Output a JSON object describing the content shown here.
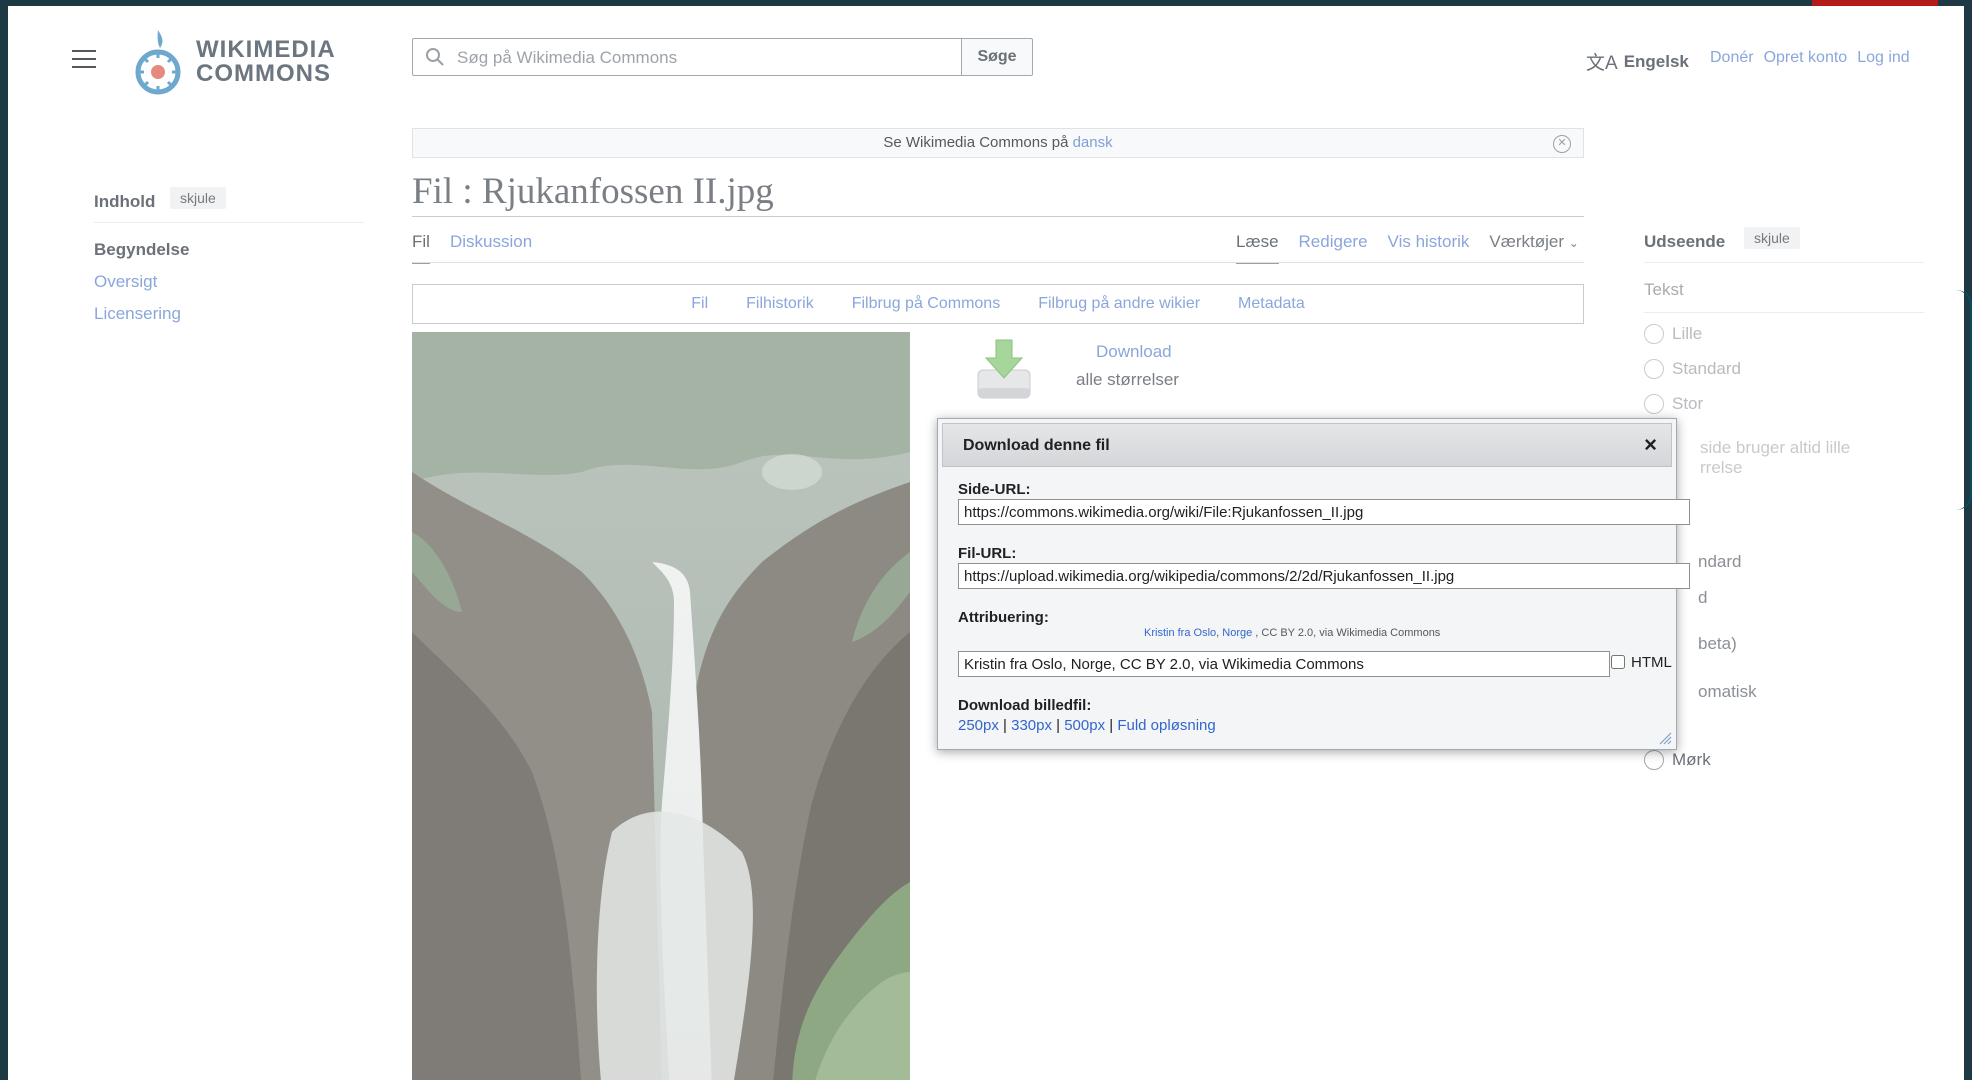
{
  "header": {
    "logo_line1": "WIKIMEDIA",
    "logo_line2": "COMMONS",
    "search_placeholder": "Søg på Wikimedia Commons",
    "search_button": "Søge",
    "language": "Engelsk",
    "language_icon": "translate-icon",
    "user_links": [
      "Donér",
      "Opret konto",
      "Log ind"
    ]
  },
  "site_notice": {
    "text": "Se Wikimedia Commons på",
    "link": "dansk"
  },
  "toc": {
    "title": "Indhold",
    "hide": "skjule",
    "items": [
      "Begyndelse",
      "Oversigt",
      "Licensering"
    ]
  },
  "page": {
    "title": "Fil : Rjukanfossen II.jpg",
    "tabs_left": [
      "Fil",
      "Diskussion"
    ],
    "tabs_right": [
      "Læse",
      "Redigere",
      "Vis historik",
      "Værktøjer"
    ],
    "file_nav": [
      "Fil",
      "Filhistorik",
      "Filbrug på Commons",
      "Filbrug på andre wikier",
      "Metadata"
    ]
  },
  "download": {
    "link": "Download",
    "sub": "alle størrelser"
  },
  "appearance": {
    "title": "Udseende",
    "hide": "skjule",
    "text_label": "Tekst",
    "options": [
      "Lille",
      "Standard",
      "Stor"
    ],
    "note_line1": "side bruger altid lille",
    "note_line2": "rrelse",
    "partial_standard": "ndard",
    "partial_d": "d",
    "partial_beta": "beta)",
    "partial_auto": "omatisk",
    "dark": "Mørk"
  },
  "dialog": {
    "title": "Download denne fil",
    "close": "×",
    "page_url_label": "Side-URL:",
    "page_url": "https://commons.wikimedia.org/wiki/File:Rjukanfossen_II.jpg",
    "file_url_label": "Fil-URL:",
    "file_url": "https://upload.wikimedia.org/wikipedia/commons/2/2d/Rjukanfossen_II.jpg",
    "attribution_label": "Attribuering:",
    "attr_author": "Kristin fra Oslo",
    "attr_sep": ", ",
    "attr_place": "Norge",
    "attr_rest": " , CC BY 2.0, via Wikimedia Commons",
    "attribution_text": "Kristin fra Oslo, Norge, CC BY 2.0, via Wikimedia Commons",
    "html_label": "HTML",
    "download_label": "Download billedfil:",
    "sizes": [
      "250px",
      "330px",
      "500px",
      "Fuld opløsning"
    ],
    "size_sep": " | "
  }
}
